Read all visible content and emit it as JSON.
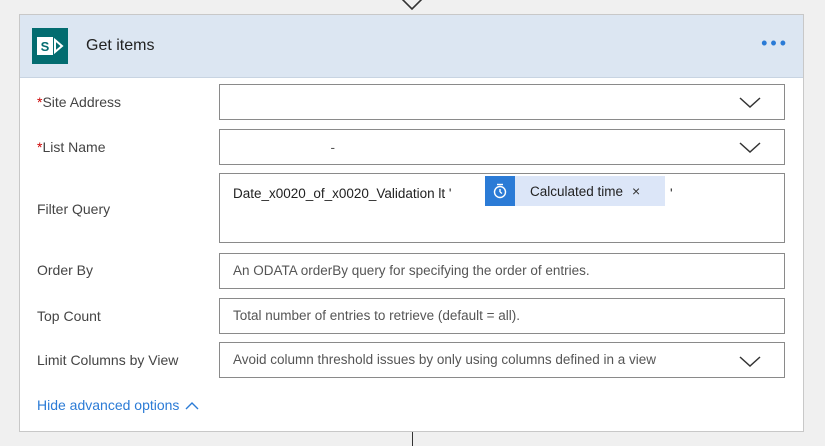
{
  "card": {
    "title": "Get items",
    "more_label": "•••",
    "icon": "sharepoint-icon"
  },
  "fields": {
    "site_address": {
      "label": "Site Address",
      "required_mark": "*",
      "value": ""
    },
    "list_name": {
      "label": "List Name",
      "required_mark": "*",
      "value": "                          -"
    },
    "filter_query": {
      "label": "Filter Query",
      "value_prefix": "Date_x0020_of_x0020_Validation lt '",
      "token_label": "Calculated time",
      "token_close": "×",
      "token_icon": "clock-icon",
      "value_suffix": "'"
    },
    "order_by": {
      "label": "Order By",
      "placeholder": "An ODATA orderBy query for specifying the order of entries."
    },
    "top_count": {
      "label": "Top Count",
      "placeholder": "Total number of entries to retrieve (default = all)."
    },
    "limit_columns": {
      "label": "Limit Columns by View",
      "placeholder": "Avoid column threshold issues by only using columns defined in a view"
    }
  },
  "advanced_link": {
    "label": "Hide advanced options"
  },
  "colors": {
    "accent": "#2b7bd6",
    "header_bg": "#dce6f2",
    "sharepoint": "#036c70"
  }
}
